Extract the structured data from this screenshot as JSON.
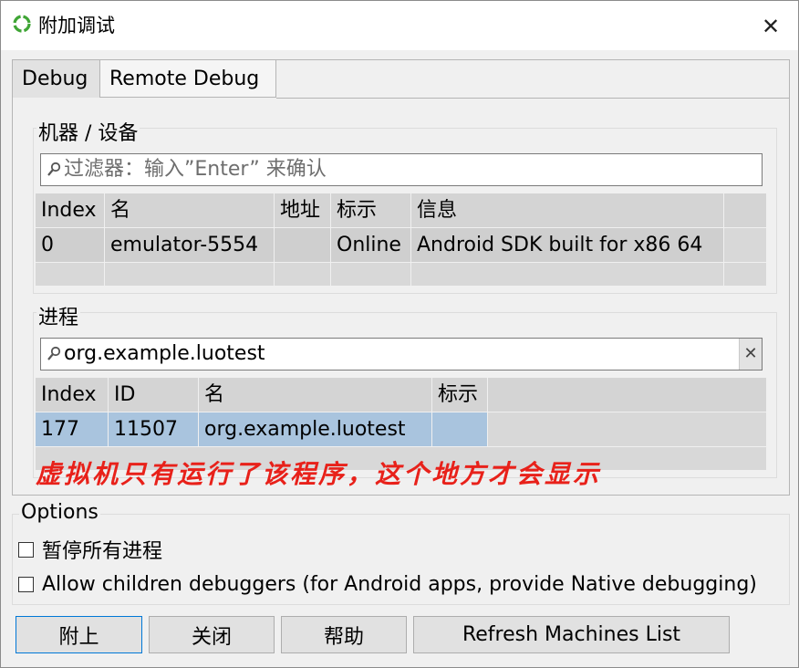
{
  "window": {
    "title": "附加调试",
    "close_symbol": "✕",
    "app_icon": "refresh-cycle-icon"
  },
  "tabs": [
    {
      "label": "Debug",
      "active": true
    },
    {
      "label": "Remote Debug",
      "active": false
    }
  ],
  "machines": {
    "title": "机器 / 设备",
    "filter_placeholder": "过滤器：输入”Enter” 来确认",
    "columns": [
      "Index",
      "名",
      "地址",
      "标示",
      "信息"
    ],
    "rows": [
      [
        "0",
        "emulator-5554",
        "",
        "Online",
        "Android SDK built for x86 64"
      ]
    ]
  },
  "processes": {
    "title": "进程",
    "filter_value": "org.example.luotest",
    "columns": [
      "Index",
      "ID",
      "名",
      "标示"
    ],
    "rows": [
      [
        "177",
        "11507",
        "org.example.luotest",
        ""
      ]
    ]
  },
  "annotation": "虚拟机只有运行了该程序，这个地方才会显示",
  "options": {
    "title": "Options",
    "pause_all": {
      "label": "暂停所有进程",
      "checked": false
    },
    "allow_children": {
      "label": "Allow children debuggers (for Android apps, provide Native debugging)",
      "checked": false
    }
  },
  "buttons": {
    "attach": "附上",
    "close": "关闭",
    "help": "帮助",
    "refresh": "Refresh Machines List"
  },
  "colors": {
    "accent_border": "#0078d7",
    "selected_process_row": "#a9c4de",
    "annotation": "#e8211a",
    "app_icon": "#3fa535"
  }
}
